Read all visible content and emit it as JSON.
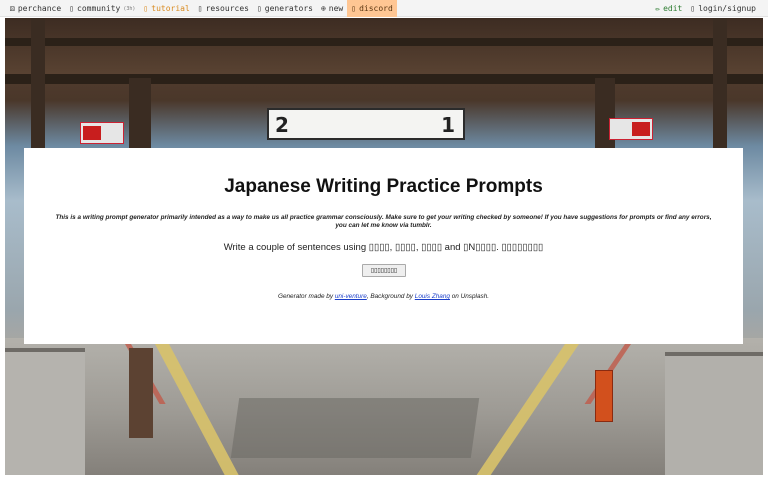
{
  "nav": {
    "left": [
      {
        "icon": "dice-icon",
        "glyph": "⚄",
        "label": "perchance",
        "sub": ""
      },
      {
        "icon": "community-icon",
        "glyph": "▯",
        "label": "community",
        "sub": "(3h)"
      },
      {
        "icon": "tutorial-icon",
        "glyph": "▯",
        "label": "tutorial",
        "sub": ""
      },
      {
        "icon": "resources-icon",
        "glyph": "▯",
        "label": "resources",
        "sub": ""
      },
      {
        "icon": "generators-icon",
        "glyph": "▯",
        "label": "generators",
        "sub": ""
      },
      {
        "icon": "plus-icon",
        "glyph": "⊕",
        "label": "new",
        "sub": ""
      },
      {
        "icon": "discord-icon",
        "glyph": "▯",
        "label": "discord",
        "sub": ""
      }
    ],
    "right": [
      {
        "icon": "pencil-icon",
        "glyph": "✏",
        "label": "edit"
      },
      {
        "icon": "user-icon",
        "glyph": "▯",
        "label": "login/signup"
      }
    ]
  },
  "hero": {
    "sign_left_number": "2",
    "sign_right_number": "1"
  },
  "card": {
    "title": "Japanese Writing Practice Prompts",
    "intro": "This is a writing prompt generator primarily intended as a way to make us all practice grammar consciously. Make sure to get your writing checked by someone! If you have suggestions for prompts or find any errors, you can let me know via tumblr.",
    "prompt": "Write a couple of sentences using ▯▯▯▯, ▯▯▯▯, ▯▯▯▯ and ▯N▯▯▯▯. ▯▯▯▯▯▯▯▯",
    "button_label": "▯▯▯▯▯▯▯▯",
    "credit_prefix": "Generator made by ",
    "credit_author": "uni-venture",
    "credit_mid": ", Background by ",
    "credit_photographer": "Louis Zhang",
    "credit_suffix": " on Unsplash."
  }
}
